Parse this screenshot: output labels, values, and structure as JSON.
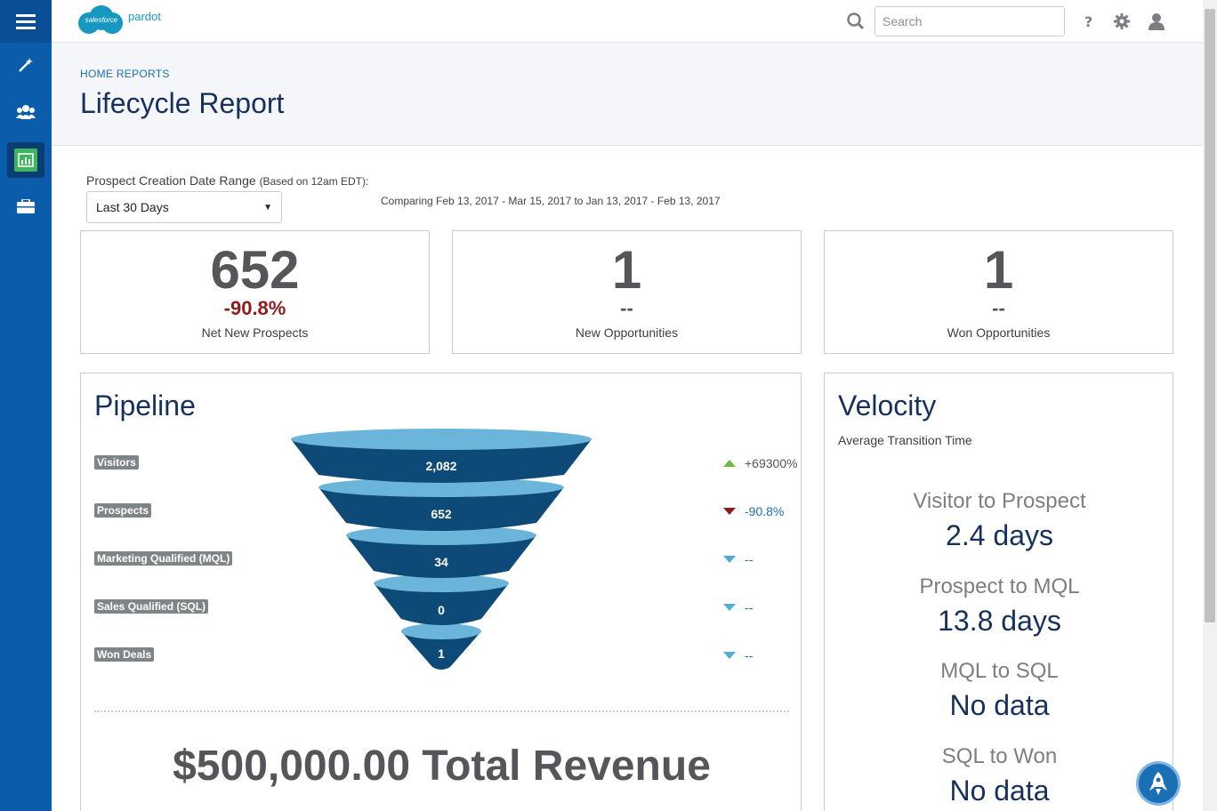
{
  "app": {
    "logo_brand": "salesforce",
    "logo_product": "pardot"
  },
  "nav": {
    "items": [
      {
        "name": "menu",
        "icon": "hamburger-icon"
      },
      {
        "name": "marketing",
        "icon": "magic-wand-icon"
      },
      {
        "name": "prospects",
        "icon": "people-icon"
      },
      {
        "name": "reports",
        "icon": "bar-chart-icon"
      },
      {
        "name": "admin",
        "icon": "briefcase-icon"
      }
    ]
  },
  "header": {
    "search_placeholder": "Search",
    "icons": [
      "search-icon",
      "help-icon",
      "gear-icon",
      "user-icon"
    ]
  },
  "page": {
    "breadcrumb": "HOME REPORTS",
    "title": "Lifecycle Report"
  },
  "filters": {
    "range_label": "Prospect Creation Date Range",
    "range_note": "(Based on 12am EDT):",
    "range_value": "Last 30 Days",
    "compare_text": "Comparing Feb 13, 2017 - Mar 15, 2017 to Jan 13, 2017 - Feb 13, 2017"
  },
  "stats": [
    {
      "value": "652",
      "change": "-90.8%",
      "label": "Net New Prospects"
    },
    {
      "value": "1",
      "change": "--",
      "label": "New Opportunities"
    },
    {
      "value": "1",
      "change": "--",
      "label": "Won Opportunities"
    }
  ],
  "pipeline": {
    "title": "Pipeline",
    "stages": [
      {
        "label": "Visitors",
        "value": "2,082",
        "trend": "+69300%",
        "direction": "up"
      },
      {
        "label": "Prospects",
        "value": "652",
        "trend": "-90.8%",
        "direction": "down-red"
      },
      {
        "label": "Marketing Qualified (MQL)",
        "value": "34",
        "trend": "--",
        "direction": "down-blue"
      },
      {
        "label": "Sales Qualified (SQL)",
        "value": "0",
        "trend": "--",
        "direction": "down-blue"
      },
      {
        "label": "Won Deals",
        "value": "1",
        "trend": "--",
        "direction": "down-blue"
      }
    ],
    "revenue": "$500,000.00 Total Revenue",
    "colors": {
      "rim": "#6bb5db",
      "body": "#0e4a78"
    }
  },
  "velocity": {
    "title": "Velocity",
    "subtitle": "Average Transition Time",
    "items": [
      {
        "label": "Visitor to Prospect",
        "value": "2.4 days"
      },
      {
        "label": "Prospect to MQL",
        "value": "13.8 days"
      },
      {
        "label": "MQL to SQL",
        "value": "No data"
      },
      {
        "label": "SQL to Won",
        "value": "No data"
      }
    ]
  }
}
